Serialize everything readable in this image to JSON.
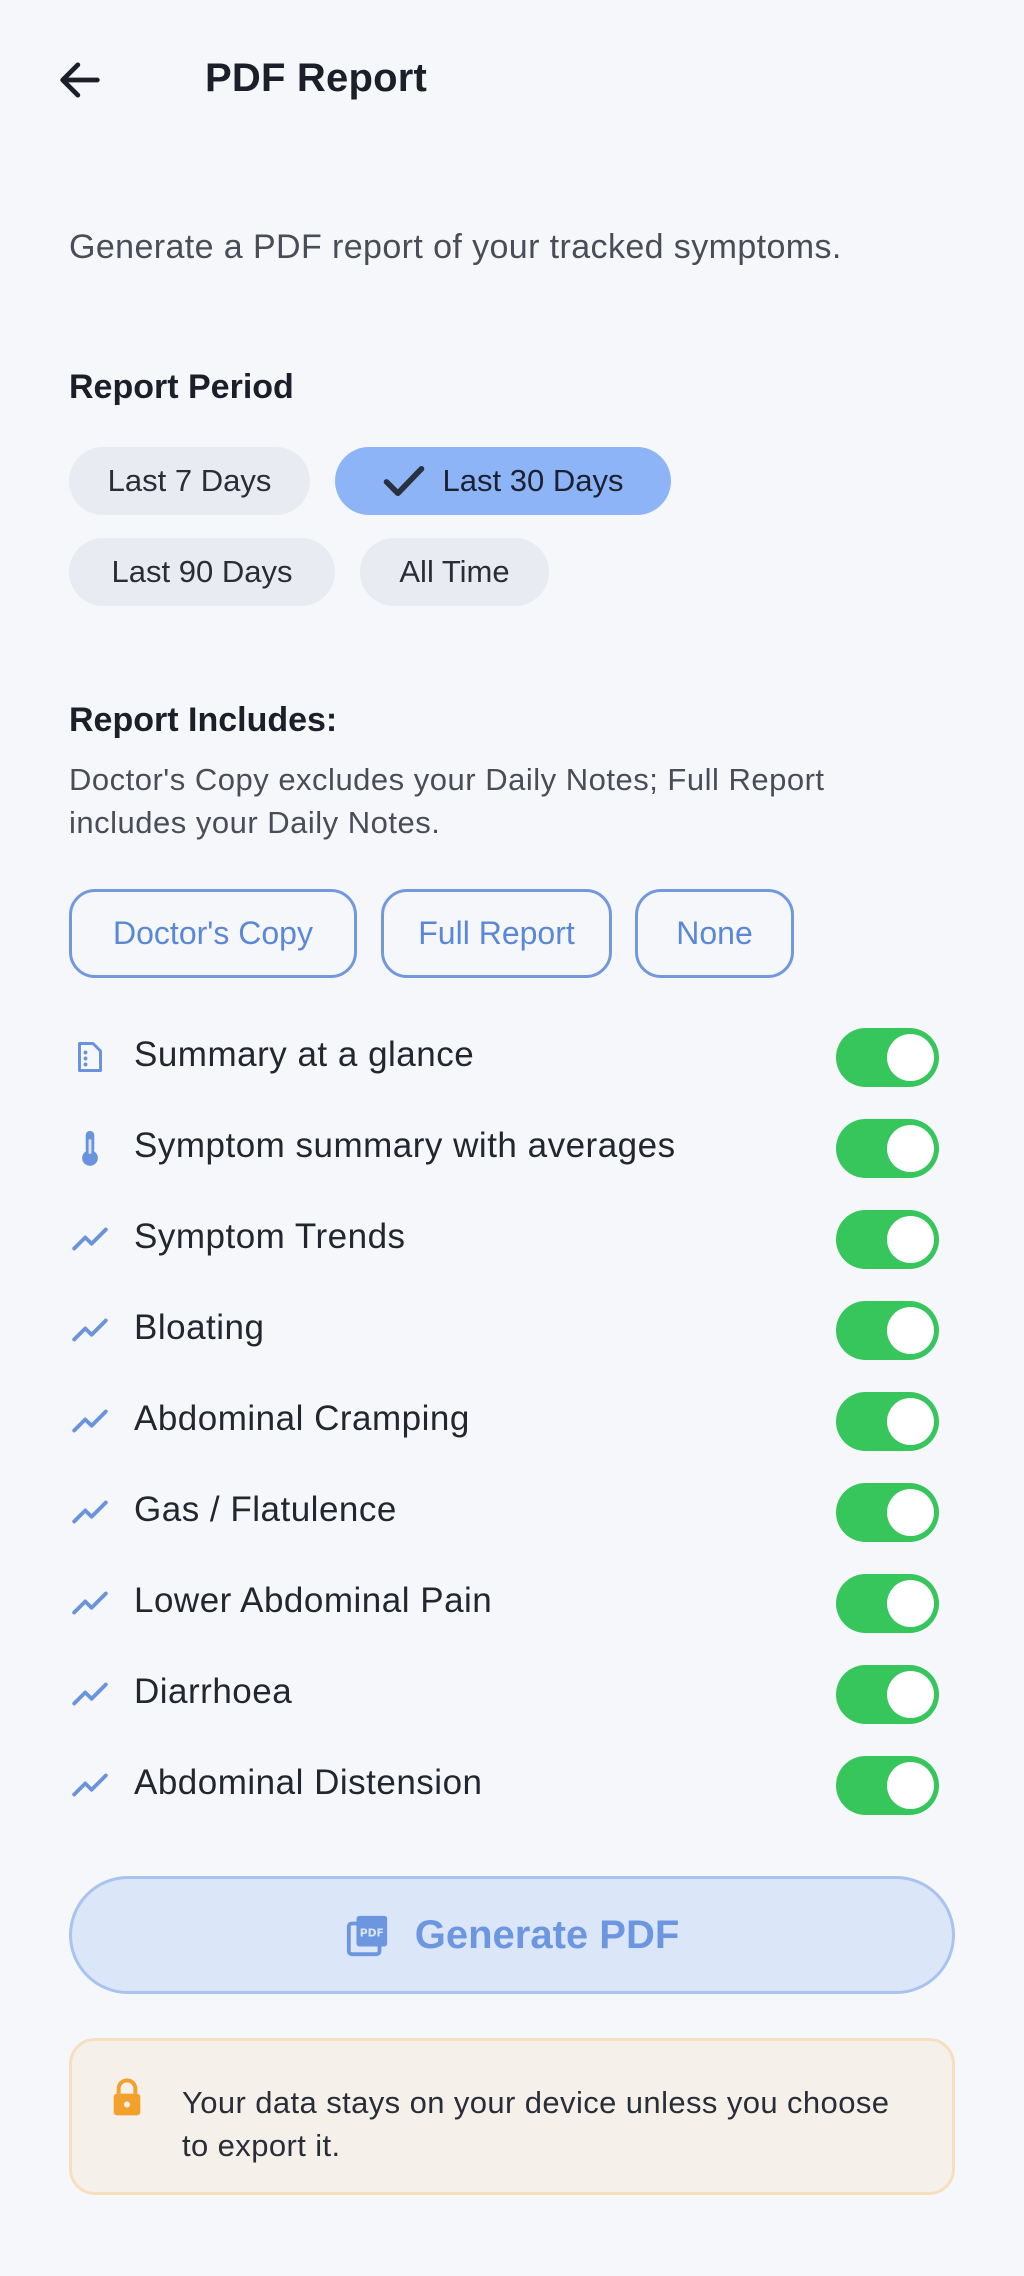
{
  "header": {
    "title": "PDF Report",
    "back_icon": "arrow-left-icon"
  },
  "intro": "Generate a PDF report of your tracked symptoms.",
  "period": {
    "title": "Report Period",
    "options": [
      {
        "label": "Last 7 Days",
        "selected": false
      },
      {
        "label": "Last 30 Days",
        "selected": true
      },
      {
        "label": "Last 90 Days",
        "selected": false
      },
      {
        "label": "All Time",
        "selected": false
      }
    ]
  },
  "includes": {
    "title": "Report Includes:",
    "description": "Doctor's Copy excludes your Daily Notes; Full Report includes your Daily Notes.",
    "presets": [
      "Doctor's Copy",
      "Full Report",
      "None"
    ],
    "items": [
      {
        "label": "Summary at a glance",
        "icon": "summary-icon",
        "enabled": true
      },
      {
        "label": "Symptom summary with averages",
        "icon": "thermometer-icon",
        "enabled": true
      },
      {
        "label": "Symptom Trends",
        "icon": "trend-icon",
        "enabled": true
      },
      {
        "label": "Bloating",
        "icon": "trend-icon",
        "enabled": true
      },
      {
        "label": "Abdominal Cramping",
        "icon": "trend-icon",
        "enabled": true
      },
      {
        "label": "Gas / Flatulence",
        "icon": "trend-icon",
        "enabled": true
      },
      {
        "label": "Lower Abdominal Pain",
        "icon": "trend-icon",
        "enabled": true
      },
      {
        "label": "Diarrhoea",
        "icon": "trend-icon",
        "enabled": true
      },
      {
        "label": "Abdominal Distension",
        "icon": "trend-icon",
        "enabled": true
      }
    ]
  },
  "generate": {
    "label": "Generate PDF",
    "icon": "pdf-icon"
  },
  "notice": {
    "text": "Your data stays on your device unless you choose to export it.",
    "icon": "lock-icon"
  },
  "colors": {
    "background": "#f6f7fb",
    "chip_selected": "#8cb4f7",
    "accent_blue": "#5b88d6",
    "toggle_on": "#37c65c",
    "lock": "#f2a22c"
  }
}
